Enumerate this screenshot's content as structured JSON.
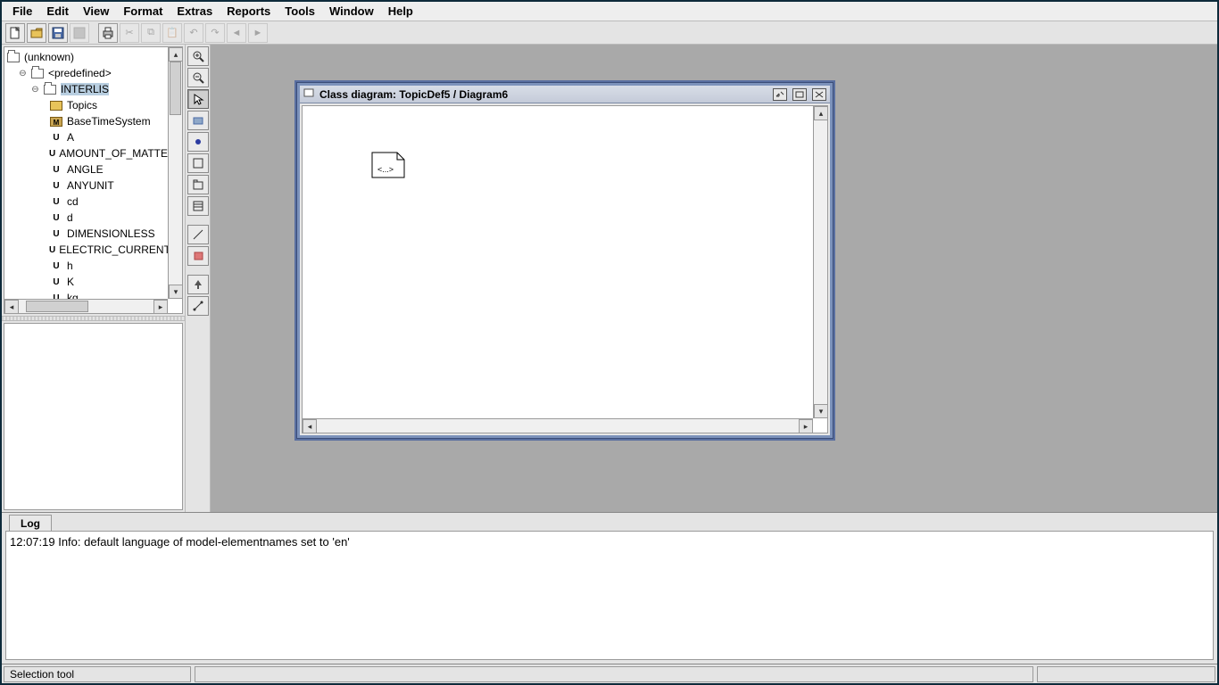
{
  "menu": {
    "items": [
      "File",
      "Edit",
      "View",
      "Format",
      "Extras",
      "Reports",
      "Tools",
      "Window",
      "Help"
    ]
  },
  "toolbar_icons": [
    "new",
    "open",
    "save",
    "saveas",
    "print",
    "cut",
    "copy",
    "paste",
    "undo",
    "redo",
    "back",
    "forward",
    "stop"
  ],
  "tree": {
    "root": "(unknown)",
    "predefined": "<predefined>",
    "interlis": "INTERLIS",
    "children": [
      {
        "kind": "yellow",
        "label": "Topics"
      },
      {
        "kind": "m",
        "label": "BaseTimeSystem"
      },
      {
        "kind": "u",
        "label": "A"
      },
      {
        "kind": "u",
        "label": "AMOUNT_OF_MATTER"
      },
      {
        "kind": "u",
        "label": "ANGLE"
      },
      {
        "kind": "u",
        "label": "ANYUNIT"
      },
      {
        "kind": "u",
        "label": "cd"
      },
      {
        "kind": "u",
        "label": "d"
      },
      {
        "kind": "u",
        "label": "DIMENSIONLESS"
      },
      {
        "kind": "u",
        "label": "ELECTRIC_CURRENT"
      },
      {
        "kind": "u",
        "label": "h"
      },
      {
        "kind": "u",
        "label": "K"
      },
      {
        "kind": "u",
        "label": "kg"
      }
    ]
  },
  "palette": [
    "zoom-in",
    "zoom-out",
    "select",
    "pan",
    "rect",
    "",
    "class",
    "package",
    "stack",
    "table",
    "",
    "line",
    "component",
    "",
    "arrow-up",
    "link"
  ],
  "internal_window": {
    "title": "Class diagram: TopicDef5 / Diagram6",
    "shape_label": "<...>"
  },
  "log": {
    "tab": "Log",
    "line": "12:07:19 Info: default language of model-elementnames set to 'en'"
  },
  "status": {
    "text": "Selection tool"
  }
}
